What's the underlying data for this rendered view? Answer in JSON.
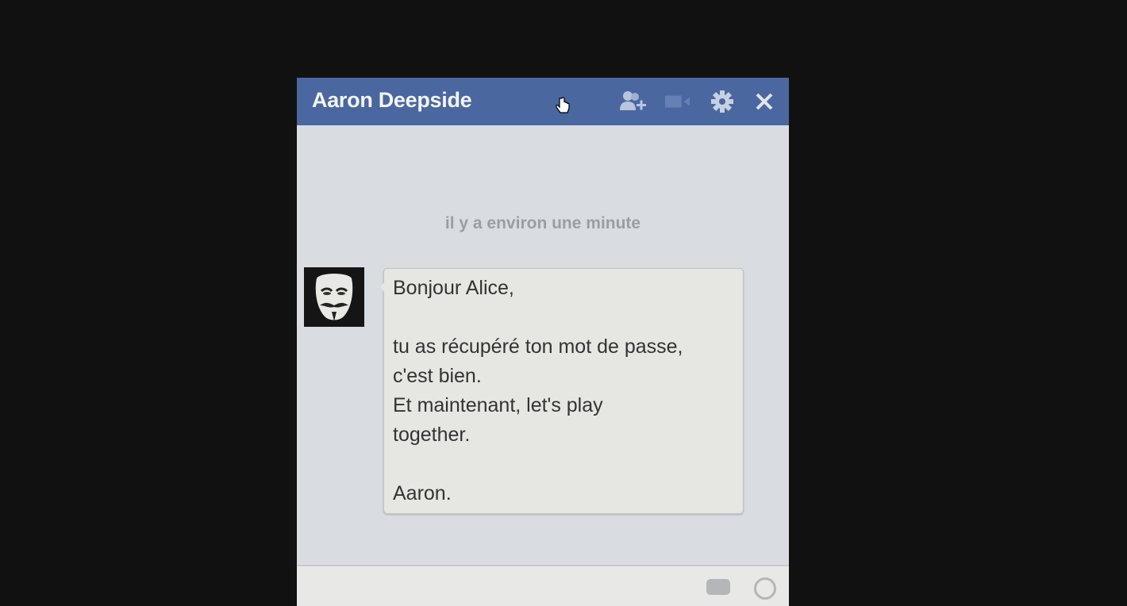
{
  "chat": {
    "title": "Aaron Deepside",
    "icons": [
      "add-friend-icon",
      "video-call-icon",
      "gear-icon",
      "close-icon"
    ],
    "header_color": "#4a67a0",
    "timestamp": "il y a environ une minute",
    "message": {
      "lines": [
        "Bonjour Alice,",
        "",
        "tu as récupéré ton mot de passe,",
        "c'est bien.",
        "Et maintenant, let's play",
        "together.",
        "",
        "Aaron."
      ]
    }
  }
}
